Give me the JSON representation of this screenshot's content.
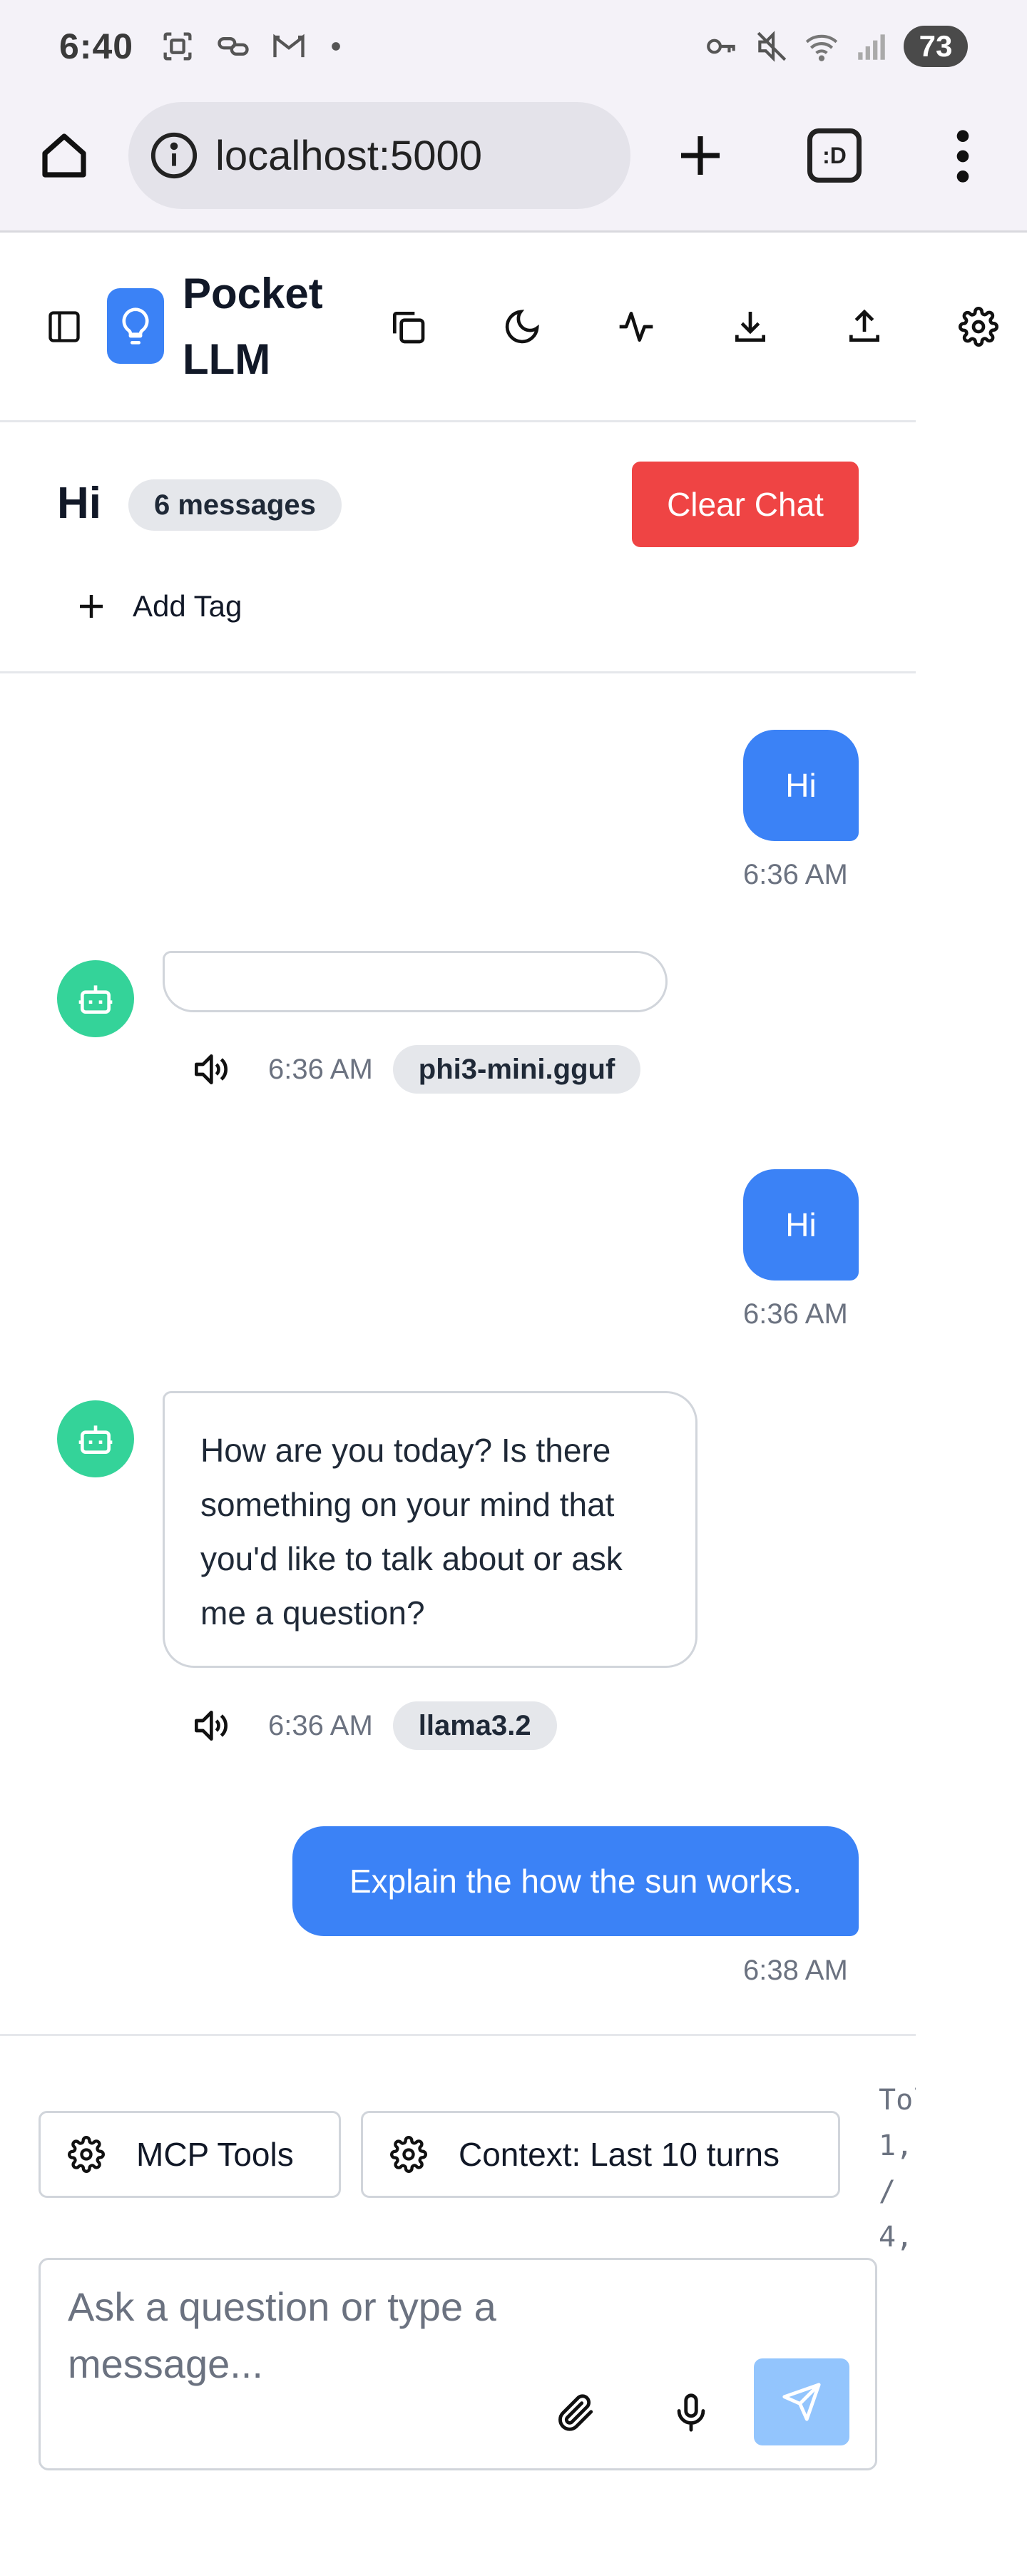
{
  "status_bar": {
    "time": "6:40",
    "battery": "73",
    "left_icons": [
      "screenshot-icon",
      "link-notification-icon",
      "gmail-icon",
      "dot-icon"
    ],
    "right_icons": [
      "key-icon",
      "mute-icon",
      "wifi-icon",
      "signal-icon"
    ]
  },
  "browser": {
    "url": "localhost:5000",
    "tab_switcher_label": ":D"
  },
  "app": {
    "title": "Pocket LLM",
    "accent": "#3b82f6",
    "header_icons": [
      "copy-icon",
      "moon-icon",
      "activity-icon",
      "download-icon",
      "upload-icon",
      "gear-icon"
    ]
  },
  "chat": {
    "title": "Hi",
    "message_count": "6 messages",
    "clear_label": "Clear Chat",
    "add_tag_label": "Add Tag"
  },
  "messages": [
    {
      "role": "user",
      "text": "Hi",
      "time": "6:36 AM"
    },
    {
      "role": "assistant",
      "text": "",
      "time": "6:36 AM",
      "model": "phi3-mini.gguf"
    },
    {
      "role": "user",
      "text": "Hi",
      "time": "6:36 AM"
    },
    {
      "role": "assistant",
      "text": "How are you today? Is there something on your mind that you'd like to talk about or ask me a question?",
      "time": "6:36 AM",
      "model": "llama3.2"
    },
    {
      "role": "user",
      "text": "Explain the how the sun works.",
      "time": "6:38 AM"
    }
  ],
  "composer": {
    "mcp_label": "MCP Tools",
    "context_label": "Context: Last 10 turns",
    "tokens_lines": [
      "Tol",
      "1,",
      "/",
      "4,"
    ],
    "placeholder": "Ask a question or type a message..."
  }
}
